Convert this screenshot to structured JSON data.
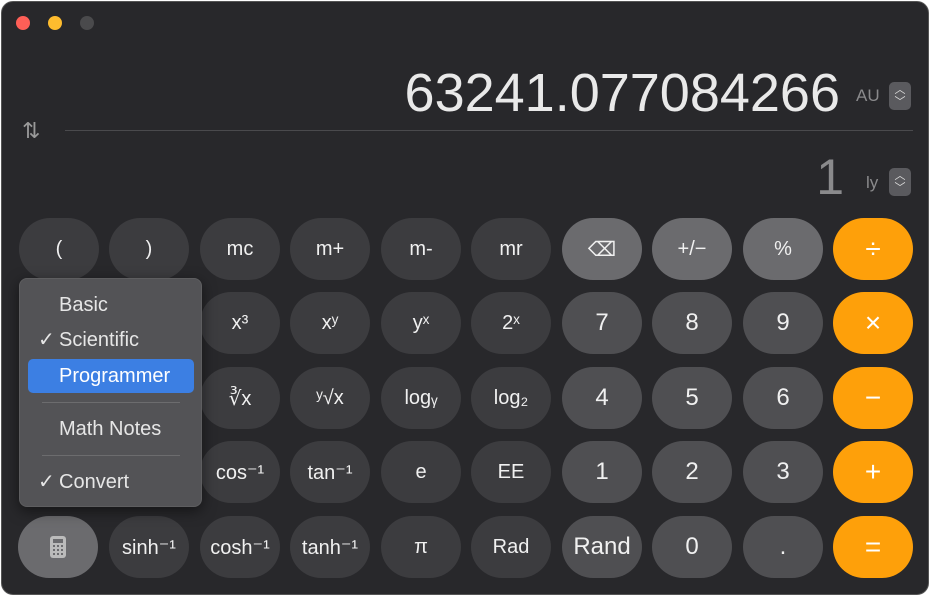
{
  "window": {
    "controls": [
      "close",
      "minimize",
      "zoom"
    ],
    "colors": {
      "close": "#fe5f57",
      "minimize": "#febc2e",
      "zoom": "#4a4a4c"
    }
  },
  "display": {
    "primary_value": "63241.077084266",
    "primary_unit": "AU",
    "secondary_value": "1",
    "secondary_unit": "ly"
  },
  "keys": [
    {
      "label": "(",
      "col": 0,
      "row": 0,
      "style": "fn"
    },
    {
      "label": ")",
      "col": 1,
      "row": 0,
      "style": "fn"
    },
    {
      "label": "mc",
      "col": 2,
      "row": 0,
      "style": "fn"
    },
    {
      "label": "m+",
      "col": 3,
      "row": 0,
      "style": "fn"
    },
    {
      "label": "m-",
      "col": 4,
      "row": 0,
      "style": "fn"
    },
    {
      "label": "mr",
      "col": 5,
      "row": 0,
      "style": "fn"
    },
    {
      "label": "⌫",
      "col": 6,
      "row": 0,
      "style": "gray",
      "name": "delete"
    },
    {
      "label": "+/−",
      "col": 7,
      "row": 0,
      "style": "gray",
      "name": "sign"
    },
    {
      "label": "%",
      "col": 8,
      "row": 0,
      "style": "gray",
      "name": "percent"
    },
    {
      "label": "÷",
      "col": 9,
      "row": 0,
      "style": "op",
      "name": "divide"
    },
    {
      "label": "x³",
      "col": 2,
      "row": 1,
      "style": "fn"
    },
    {
      "label": "xʸ",
      "col": 3,
      "row": 1,
      "style": "fn"
    },
    {
      "label": "yˣ",
      "col": 4,
      "row": 1,
      "style": "fn"
    },
    {
      "label": "2ˣ",
      "col": 5,
      "row": 1,
      "style": "fn"
    },
    {
      "label": "7",
      "col": 6,
      "row": 1,
      "style": "digit"
    },
    {
      "label": "8",
      "col": 7,
      "row": 1,
      "style": "digit"
    },
    {
      "label": "9",
      "col": 8,
      "row": 1,
      "style": "digit"
    },
    {
      "label": "×",
      "col": 9,
      "row": 1,
      "style": "op",
      "name": "multiply"
    },
    {
      "label": "∛x",
      "col": 2,
      "row": 2,
      "style": "fn"
    },
    {
      "label": "ʸ√x",
      "col": 3,
      "row": 2,
      "style": "fn"
    },
    {
      "label": "logᵧ",
      "col": 4,
      "row": 2,
      "style": "fn"
    },
    {
      "label": "log₂",
      "col": 5,
      "row": 2,
      "style": "fn"
    },
    {
      "label": "4",
      "col": 6,
      "row": 2,
      "style": "digit"
    },
    {
      "label": "5",
      "col": 7,
      "row": 2,
      "style": "digit"
    },
    {
      "label": "6",
      "col": 8,
      "row": 2,
      "style": "digit"
    },
    {
      "label": "−",
      "col": 9,
      "row": 2,
      "style": "op",
      "name": "subtract"
    },
    {
      "label": "cos⁻¹",
      "col": 2,
      "row": 3,
      "style": "fn"
    },
    {
      "label": "tan⁻¹",
      "col": 3,
      "row": 3,
      "style": "fn"
    },
    {
      "label": "e",
      "col": 4,
      "row": 3,
      "style": "fn"
    },
    {
      "label": "EE",
      "col": 5,
      "row": 3,
      "style": "fn"
    },
    {
      "label": "1",
      "col": 6,
      "row": 3,
      "style": "digit"
    },
    {
      "label": "2",
      "col": 7,
      "row": 3,
      "style": "digit"
    },
    {
      "label": "3",
      "col": 8,
      "row": 3,
      "style": "digit"
    },
    {
      "label": "+",
      "col": 9,
      "row": 3,
      "style": "op",
      "name": "add"
    },
    {
      "label": "sinh⁻¹",
      "col": 1,
      "row": 4,
      "style": "fn"
    },
    {
      "label": "cosh⁻¹",
      "col": 2,
      "row": 4,
      "style": "fn"
    },
    {
      "label": "tanh⁻¹",
      "col": 3,
      "row": 4,
      "style": "fn"
    },
    {
      "label": "π",
      "col": 4,
      "row": 4,
      "style": "fn"
    },
    {
      "label": "Rad",
      "col": 5,
      "row": 4,
      "style": "fn"
    },
    {
      "label": "Rand",
      "col": 6,
      "row": 4,
      "style": "digit"
    },
    {
      "label": "0",
      "col": 7,
      "row": 4,
      "style": "digit"
    },
    {
      "label": ".",
      "col": 8,
      "row": 4,
      "style": "digit"
    },
    {
      "label": "=",
      "col": 9,
      "row": 4,
      "style": "op",
      "name": "equals"
    }
  ],
  "mode_menu": {
    "items": [
      {
        "label": "Basic",
        "checked": false,
        "highlighted": false
      },
      {
        "label": "Scientific",
        "checked": true,
        "highlighted": false
      },
      {
        "label": "Programmer",
        "checked": false,
        "highlighted": true
      },
      {
        "label": "Math Notes",
        "checked": false,
        "highlighted": false
      },
      {
        "label": "Convert",
        "checked": true,
        "highlighted": false
      }
    ],
    "check_glyph": "✓",
    "highlight_color": "#3c7fe3"
  },
  "accent": "#fea00a"
}
